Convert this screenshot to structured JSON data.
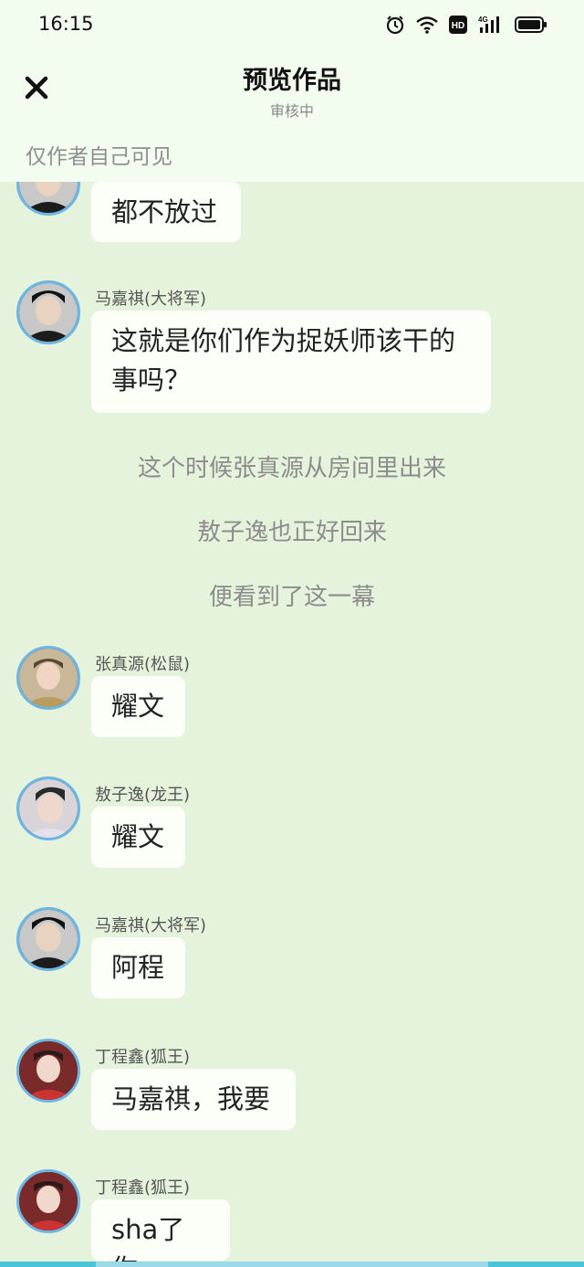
{
  "status": {
    "time": "16:15"
  },
  "header": {
    "title": "预览作品",
    "subtitle": "审核中",
    "visibility_note": "仅作者自己可见"
  },
  "chat": {
    "top_bubble": "都不放过",
    "messages": [
      {
        "name": "马嘉祺(大将军)",
        "text_line1": "这就是你们作为捉妖师该干的",
        "text_line2": "事吗？"
      },
      {
        "name": "张真源(松鼠)",
        "text": "耀文"
      },
      {
        "name": "敖子逸(龙王)",
        "text": "耀文"
      },
      {
        "name": "马嘉祺(大将军)",
        "text": "阿程"
      },
      {
        "name": "丁程鑫(狐王)",
        "text": "马嘉祺，我要"
      },
      {
        "name": "丁程鑫(狐王)",
        "text": "sha了你"
      }
    ],
    "narration": [
      "这个时候张真源从房间里出来",
      "敖子逸也正好回来",
      "便看到了这一幕"
    ]
  },
  "colors": {
    "background": "#e6f3dc",
    "header": "#f3fdef",
    "avatar_ring": "#6cb6e6",
    "bubble": "#fbfff8"
  }
}
